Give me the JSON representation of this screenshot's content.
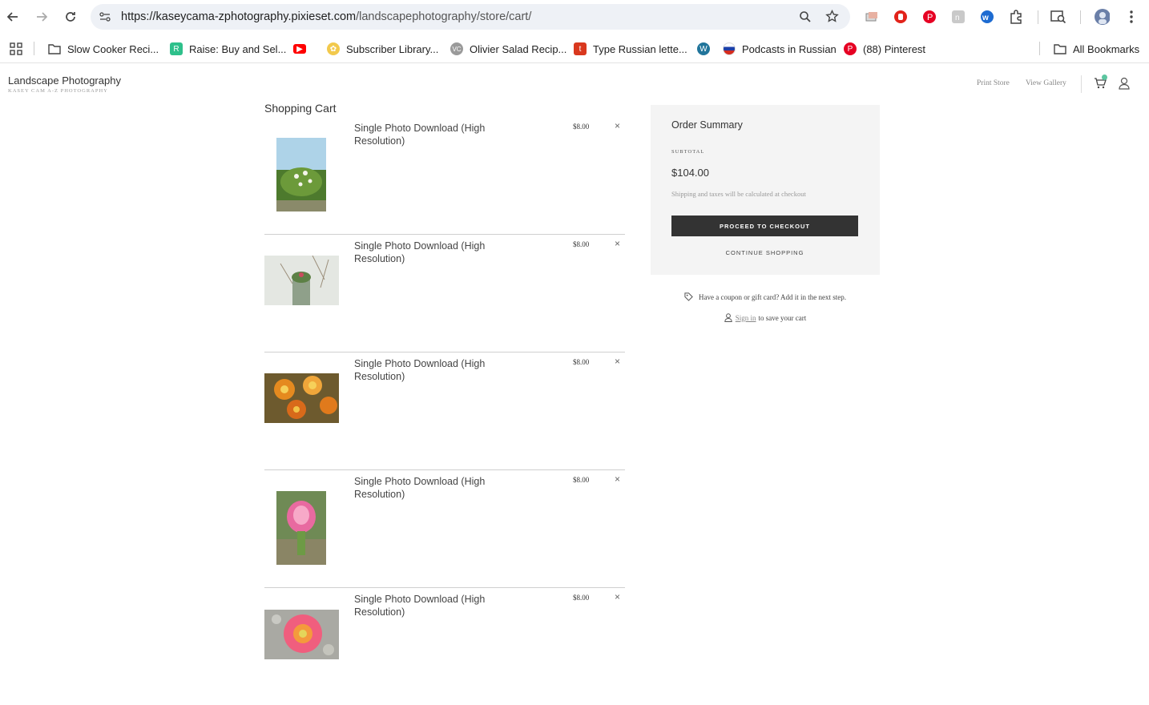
{
  "browser": {
    "url_host": "https://kaseycama-zphotography.pixieset.com",
    "url_path": "/landscapephotography/store/cart/"
  },
  "bookmarks": [
    {
      "label": "Slow Cooker Reci...",
      "icon": "folder-icon"
    },
    {
      "label": "Raise: Buy and Sel...",
      "icon": "raise-icon"
    },
    {
      "label": "",
      "icon": "youtube-icon"
    },
    {
      "label": "Subscriber Library...",
      "icon": "flower-icon"
    },
    {
      "label": "Olivier Salad Recip...",
      "icon": "vc-icon"
    },
    {
      "label": "Type Russian lette...",
      "icon": "t-icon"
    },
    {
      "label": "",
      "icon": "wordpress-icon"
    },
    {
      "label": "Podcasts in Russian",
      "icon": "russia-flag-icon"
    },
    {
      "label": "(88) Pinterest",
      "icon": "pinterest-icon"
    }
  ],
  "all_bookmarks": "All Bookmarks",
  "site": {
    "title": "Landscape Photography",
    "subtitle": "KASEY CAM A-Z PHOTOGRAPHY",
    "nav": [
      "Print Store",
      "View Gallery"
    ]
  },
  "cart": {
    "title": "Shopping Cart",
    "items": [
      {
        "name": "Single Photo Download (High Resolution)",
        "price": "$8.00",
        "remove": "×"
      },
      {
        "name": "Single Photo Download (High Resolution)",
        "price": "$8.00",
        "remove": "×"
      },
      {
        "name": "Single Photo Download (High Resolution)",
        "price": "$8.00",
        "remove": "×"
      },
      {
        "name": "Single Photo Download (High Resolution)",
        "price": "$8.00",
        "remove": "×"
      },
      {
        "name": "Single Photo Download (High Resolution)",
        "price": "$8.00",
        "remove": "×"
      }
    ]
  },
  "summary": {
    "title": "Order Summary",
    "subtotal_label": "SUBTOTAL",
    "subtotal": "$104.00",
    "note": "Shipping and taxes will be calculated at checkout",
    "checkout": "PROCEED TO CHECKOUT",
    "continue": "CONTINUE SHOPPING",
    "coupon": "Have a coupon or gift card? Add it in the next step.",
    "signin_link": "Sign in",
    "signin_rest": "to save your cart"
  },
  "colors": {
    "accent": "#333333",
    "badge": "#5cc6a0"
  }
}
